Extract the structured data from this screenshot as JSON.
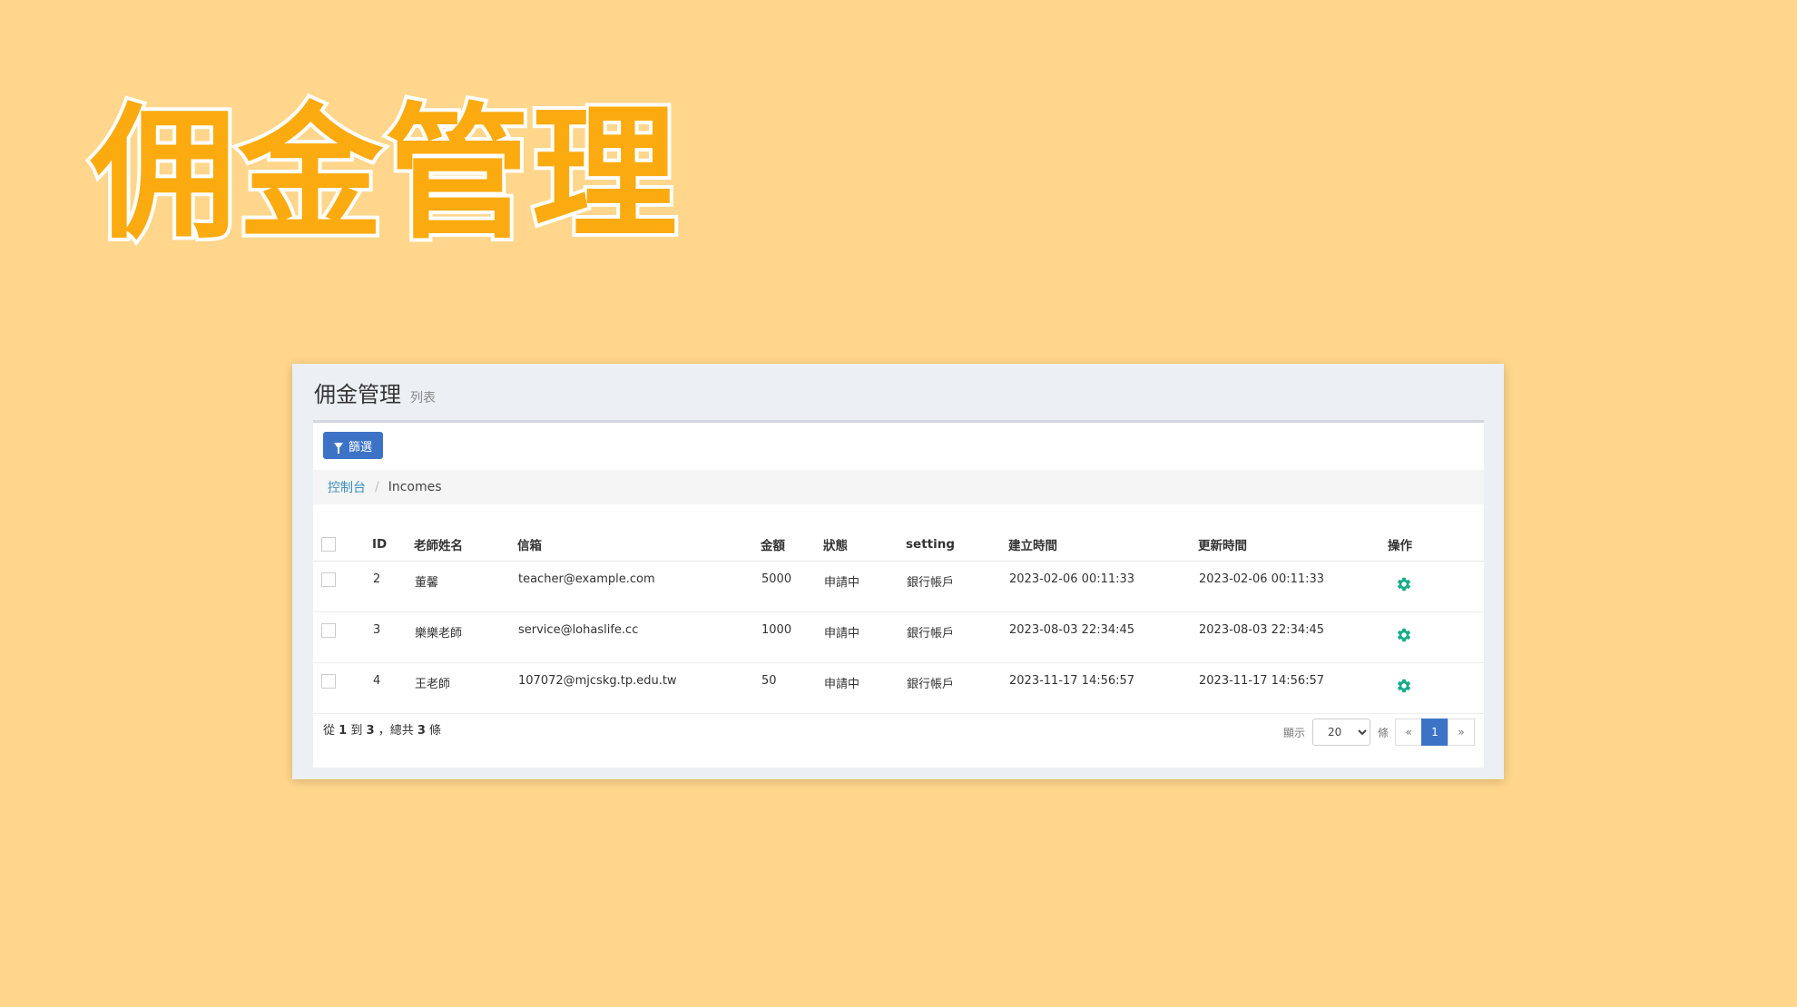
{
  "hero": {
    "title": "佣金管理"
  },
  "page": {
    "title": "佣金管理",
    "subtitle": "列表"
  },
  "toolbar": {
    "filter_label": "篩選"
  },
  "breadcrumb": {
    "home": "控制台",
    "separator": "/",
    "current": "Incomes"
  },
  "table": {
    "headers": {
      "id": "ID",
      "teacher": "老師姓名",
      "email": "信箱",
      "amount": "金額",
      "status": "狀態",
      "setting": "setting",
      "created": "建立時間",
      "updated": "更新時間",
      "ops": "操作"
    },
    "rows": [
      {
        "id": "2",
        "teacher": "董馨",
        "email": "teacher@example.com",
        "amount": "5000",
        "status": "申請中",
        "setting": "銀行帳戶",
        "created": "2023-02-06 00:11:33",
        "updated": "2023-02-06 00:11:33"
      },
      {
        "id": "3",
        "teacher": "樂樂老師",
        "email": "service@lohaslife.cc",
        "amount": "1000",
        "status": "申請中",
        "setting": "銀行帳戶",
        "created": "2023-08-03 22:34:45",
        "updated": "2023-08-03 22:34:45"
      },
      {
        "id": "4",
        "teacher": "王老師",
        "email": "107072@mjcskg.tp.edu.tw",
        "amount": "50",
        "status": "申請中",
        "setting": "銀行帳戶",
        "created": "2023-11-17 14:56:57",
        "updated": "2023-11-17 14:56:57"
      }
    ]
  },
  "footer": {
    "from_label": "從",
    "from": "1",
    "to_label": "到",
    "to": "3",
    "total_label": "，總共",
    "total": "3",
    "unit": "條"
  },
  "pager": {
    "show_label": "顯示",
    "per_page": "20",
    "per_page_unit": "條",
    "prev": "«",
    "current": "1",
    "next": "»"
  },
  "colors": {
    "accent": "#3c73c6",
    "hero": "#fbab10",
    "gear": "#1aab8a",
    "background": "#ffd68b"
  }
}
